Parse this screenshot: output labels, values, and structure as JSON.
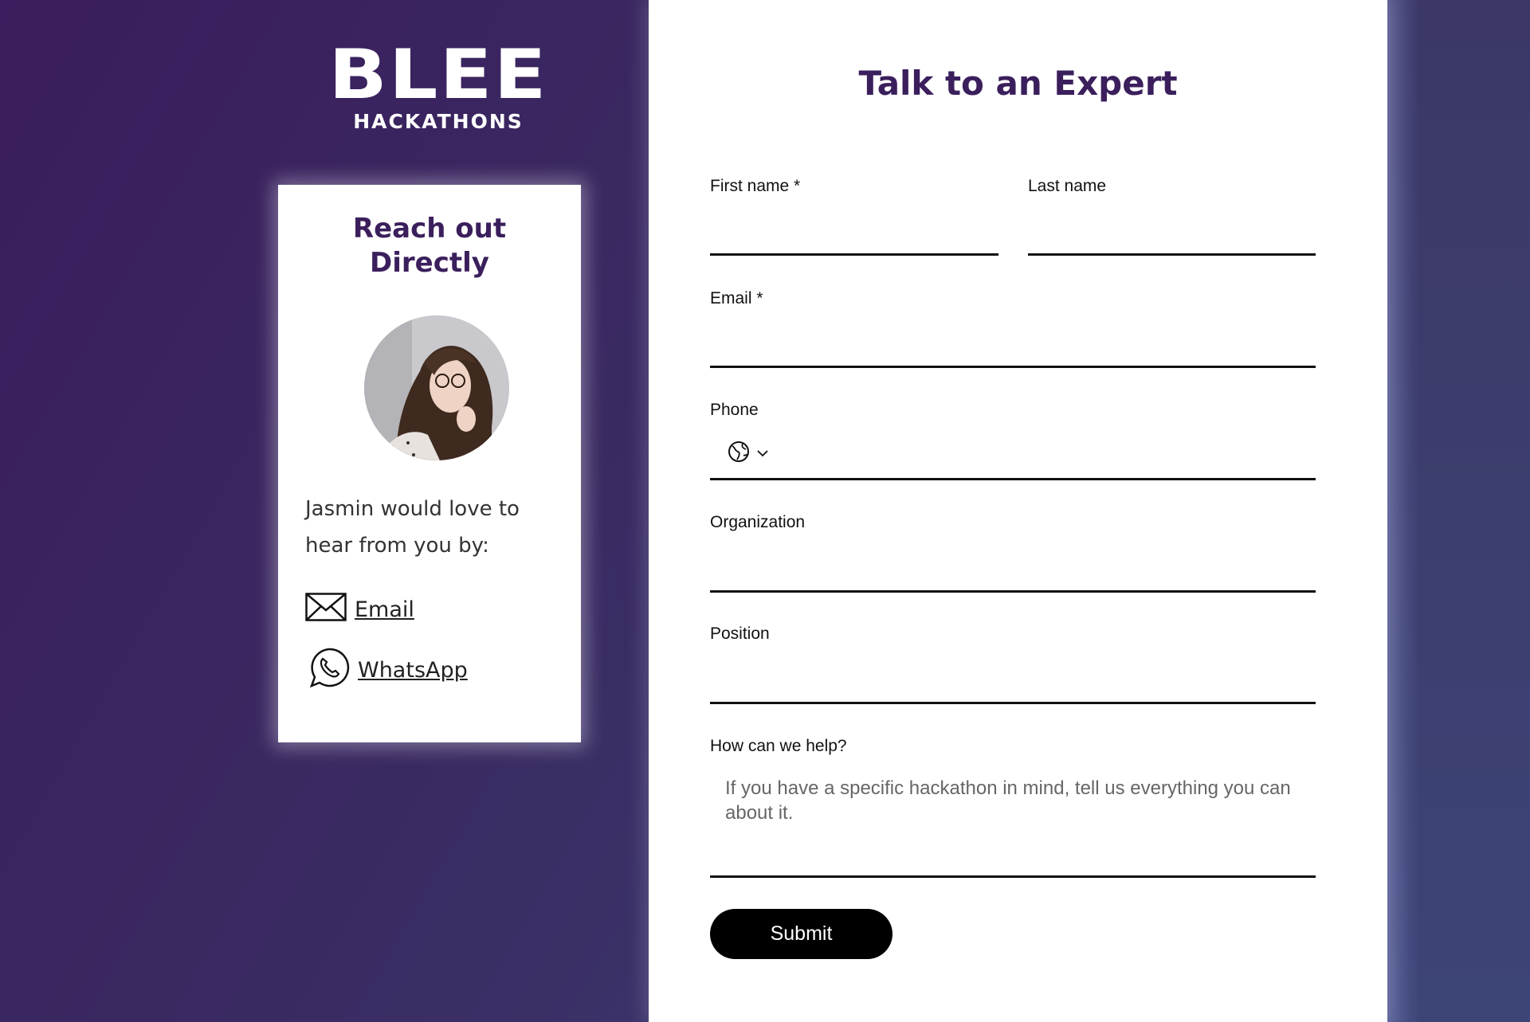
{
  "logo": {
    "word": "BLEE",
    "sub": "HACKATHONS"
  },
  "card": {
    "title": "Reach out\nDirectly",
    "text": "Jasmin would love to hear from you by:",
    "email_label": "Email",
    "whatsapp_label": "WhatsApp"
  },
  "form": {
    "title": "Talk to an Expert",
    "first_name_label": "First name *",
    "last_name_label": "Last name",
    "email_label": "Email *",
    "phone_label": "Phone",
    "organization_label": "Organization",
    "position_label": "Position",
    "help_label": "How can we help?",
    "help_placeholder": "If you have a specific hackathon in mind, tell us everything you can about it.",
    "submit_label": "Submit"
  },
  "colors": {
    "brand_purple": "#3b1f5c",
    "button": "#000000"
  },
  "icons": [
    "envelope-icon",
    "whatsapp-icon",
    "globe-icon",
    "chevron-down-icon"
  ]
}
